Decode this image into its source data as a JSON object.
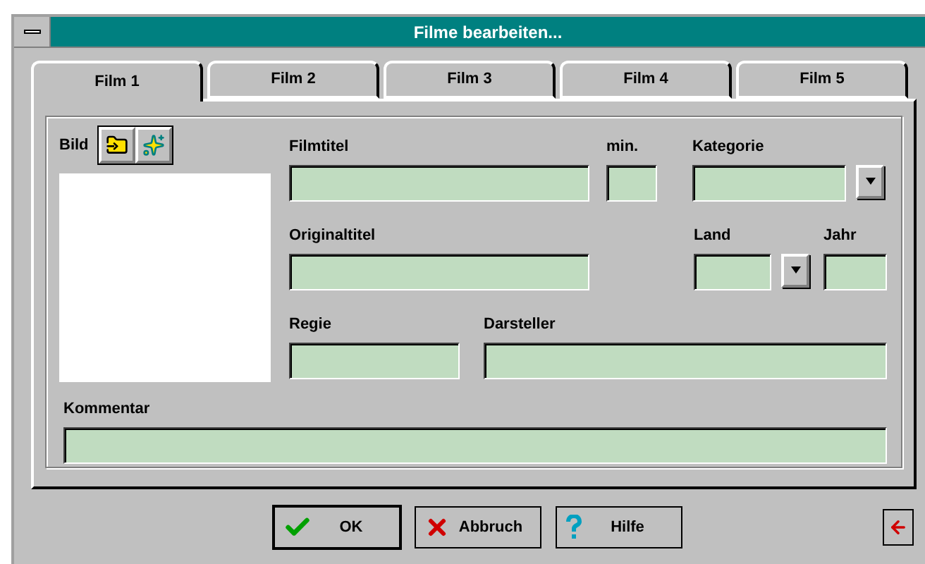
{
  "window": {
    "title": "Filme bearbeiten..."
  },
  "tabs": [
    {
      "label": "Film 1",
      "selected": true
    },
    {
      "label": "Film 2",
      "selected": false
    },
    {
      "label": "Film 3",
      "selected": false
    },
    {
      "label": "Film 4",
      "selected": false
    },
    {
      "label": "Film 5",
      "selected": false
    }
  ],
  "image": {
    "label": "Bild"
  },
  "fields": [
    {
      "label": "Filmtitel",
      "kind": "text"
    },
    {
      "label": "min.",
      "kind": "text"
    },
    {
      "label": "Kategorie",
      "kind": "dropdown"
    },
    {
      "label": "Originaltitel",
      "kind": "text"
    },
    {
      "label": "Land",
      "kind": "dropdown"
    },
    {
      "label": "Jahr",
      "kind": "text"
    },
    {
      "label": "Regie",
      "kind": "text"
    },
    {
      "label": "Darsteller",
      "kind": "text"
    },
    {
      "label": "Kommentar",
      "kind": "text"
    }
  ],
  "buttons": [
    {
      "label": "OK",
      "kind": "ok"
    },
    {
      "label": "Abbruch",
      "kind": "cancel"
    },
    {
      "label": "Hilfe",
      "kind": "help"
    }
  ]
}
